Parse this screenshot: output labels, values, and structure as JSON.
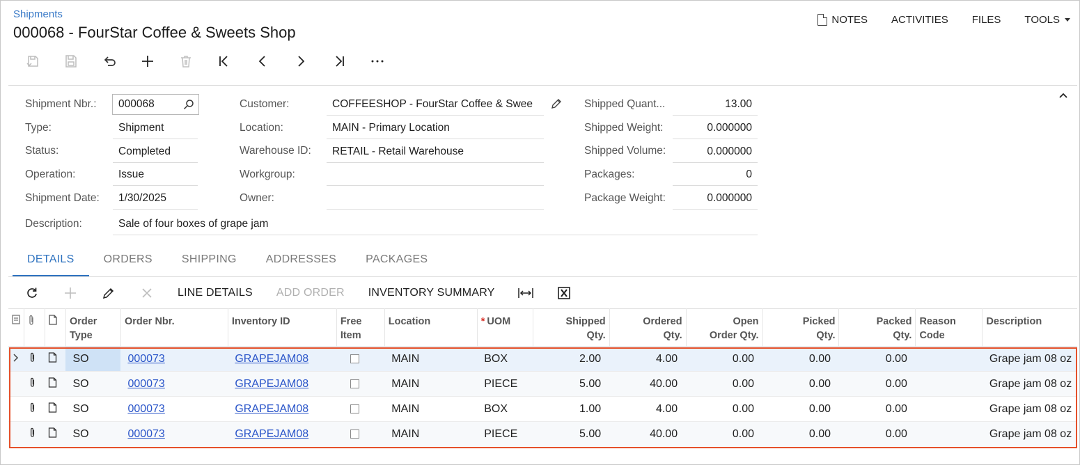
{
  "breadcrumb": "Shipments",
  "title": "000068 - FourStar Coffee & Sweets Shop",
  "top_actions": [
    {
      "label": "NOTES",
      "icon": "document-icon"
    },
    {
      "label": "ACTIVITIES"
    },
    {
      "label": "FILES"
    },
    {
      "label": "TOOLS",
      "icon": "caret-down-icon"
    }
  ],
  "toolbar_icons": [
    "save-close-icon",
    "save-icon",
    "undo-icon",
    "add-icon",
    "delete-icon",
    "first-icon",
    "previous-icon",
    "next-icon",
    "last-icon",
    "more-icon"
  ],
  "form": {
    "shipment_nbr": {
      "label": "Shipment Nbr.:",
      "value": "000068"
    },
    "type": {
      "label": "Type:",
      "value": "Shipment"
    },
    "status": {
      "label": "Status:",
      "value": "Completed"
    },
    "operation": {
      "label": "Operation:",
      "value": "Issue"
    },
    "shipment_date": {
      "label": "Shipment Date:",
      "value": "1/30/2025"
    },
    "description": {
      "label": "Description:",
      "value": "Sale of four boxes of grape jam"
    },
    "customer": {
      "label": "Customer:",
      "value": "COFFEESHOP - FourStar Coffee & Swee"
    },
    "location": {
      "label": "Location:",
      "value": "MAIN - Primary Location"
    },
    "warehouse": {
      "label": "Warehouse ID:",
      "value": "RETAIL - Retail Warehouse"
    },
    "workgroup": {
      "label": "Workgroup:",
      "value": ""
    },
    "owner": {
      "label": "Owner:",
      "value": ""
    },
    "shipped_quantity": {
      "label": "Shipped Quant...",
      "value": "13.00"
    },
    "shipped_weight": {
      "label": "Shipped Weight:",
      "value": "0.000000"
    },
    "shipped_volume": {
      "label": "Shipped Volume:",
      "value": "0.000000"
    },
    "packages": {
      "label": "Packages:",
      "value": "0"
    },
    "package_weight": {
      "label": "Package Weight:",
      "value": "0.000000"
    }
  },
  "tabs": [
    "DETAILS",
    "ORDERS",
    "SHIPPING",
    "ADDRESSES",
    "PACKAGES"
  ],
  "active_tab": "DETAILS",
  "grid_toolbar": {
    "line_details": "LINE DETAILS",
    "add_order": "ADD ORDER",
    "inventory_summary": "INVENTORY SUMMARY"
  },
  "columns": {
    "order_type": [
      "Order",
      "Type"
    ],
    "order_nbr": "Order Nbr.",
    "inventory_id": "Inventory ID",
    "free_item": [
      "Free",
      "Item"
    ],
    "location": "Location",
    "uom": "UOM",
    "shipped_qty": [
      "Shipped",
      "Qty."
    ],
    "ordered_qty": [
      "Ordered",
      "Qty."
    ],
    "open_order_qty": [
      "Open",
      "Order Qty."
    ],
    "picked_qty": [
      "Picked",
      "Qty."
    ],
    "packed_qty": [
      "Packed",
      "Qty."
    ],
    "reason_code": [
      "Reason",
      "Code"
    ],
    "description": "Description"
  },
  "rows": [
    {
      "order_type": "SO",
      "order_nbr": "000073",
      "inventory_id": "GRAPEJAM08",
      "location": "MAIN",
      "uom": "BOX",
      "shipped": "2.00",
      "ordered": "4.00",
      "open": "0.00",
      "picked": "0.00",
      "packed": "0.00",
      "reason": "",
      "description": "Grape jam 08 oz"
    },
    {
      "order_type": "SO",
      "order_nbr": "000073",
      "inventory_id": "GRAPEJAM08",
      "location": "MAIN",
      "uom": "PIECE",
      "shipped": "5.00",
      "ordered": "40.00",
      "open": "0.00",
      "picked": "0.00",
      "packed": "0.00",
      "reason": "",
      "description": "Grape jam 08 oz"
    },
    {
      "order_type": "SO",
      "order_nbr": "000073",
      "inventory_id": "GRAPEJAM08",
      "location": "MAIN",
      "uom": "BOX",
      "shipped": "1.00",
      "ordered": "4.00",
      "open": "0.00",
      "picked": "0.00",
      "packed": "0.00",
      "reason": "",
      "description": "Grape jam 08 oz"
    },
    {
      "order_type": "SO",
      "order_nbr": "000073",
      "inventory_id": "GRAPEJAM08",
      "location": "MAIN",
      "uom": "PIECE",
      "shipped": "5.00",
      "ordered": "40.00",
      "open": "0.00",
      "picked": "0.00",
      "packed": "0.00",
      "reason": "",
      "description": "Grape jam 08 oz"
    }
  ],
  "colors": {
    "accent": "#2f73c0",
    "link": "#2a55c9",
    "highlight_border": "#e5502a",
    "required": "#d9342b"
  }
}
